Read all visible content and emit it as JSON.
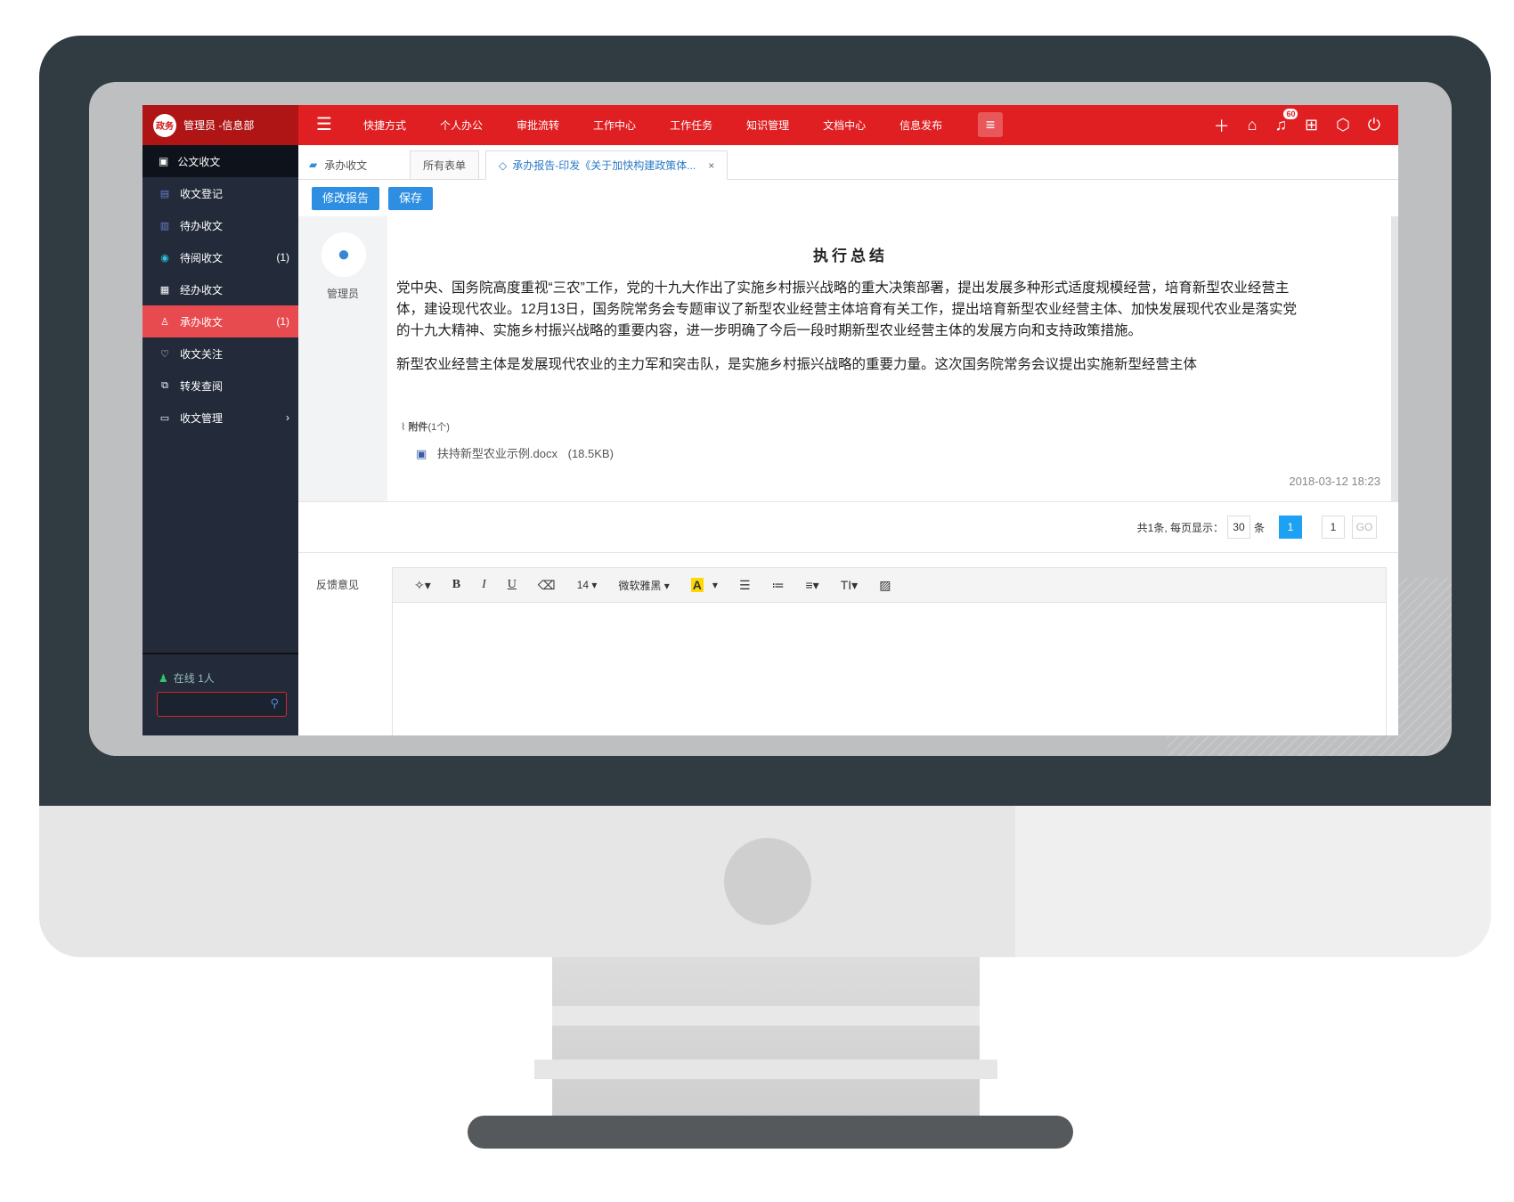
{
  "brand": {
    "logo_text": "政务",
    "user_text": "管理员 -信息部"
  },
  "topnav": {
    "items": [
      "快捷方式",
      "个人办公",
      "审批流转",
      "工作中心",
      "工作任务",
      "知识管理",
      "文档中心",
      "信息发布"
    ],
    "notification_count": "60"
  },
  "sidebar": {
    "header": "公文收文",
    "items": [
      {
        "label": "收文登记",
        "count": "",
        "icon": "register-icon"
      },
      {
        "label": "待办收文",
        "count": "",
        "icon": "todo-icon"
      },
      {
        "label": "待阅收文",
        "count": "(1)",
        "icon": "eye-icon"
      },
      {
        "label": "经办收文",
        "count": "",
        "icon": "handled-icon"
      },
      {
        "label": "承办收文",
        "count": "(1)",
        "icon": "user-icon"
      },
      {
        "label": "收文关注",
        "count": "",
        "icon": "heart-icon"
      },
      {
        "label": "转发查阅",
        "count": "",
        "icon": "forward-icon"
      },
      {
        "label": "收文管理",
        "count": "",
        "icon": "folder-icon"
      }
    ],
    "active_index": 4,
    "online_text": "在线 1人",
    "search_placeholder": ""
  },
  "tabs": {
    "home": "承办收文",
    "all": "所有表单",
    "current": "承办报告-印发《关于加快构建政策体..."
  },
  "buttons": {
    "modify": "修改报告",
    "save": "保存"
  },
  "document": {
    "author": "管理员",
    "title": "执行总结",
    "paragraph1": "党中央、国务院高度重视“三农”工作，党的十九大作出了实施乡村振兴战略的重大决策部署，提出发展多种形式适度规模经营，培育新型农业经营主体，建设现代农业。12月13日，国务院常务会专题审议了新型农业经营主体培育有关工作，提出培育新型农业经营主体、加快发展现代农业是落实党的十九大精神、实施乡村振兴战略的重要内容，进一步明确了今后一段时期新型农业经营主体的发展方向和支持政策措施。",
    "paragraph2": "新型农业经营主体是发展现代农业的主力军和突击队，是实施乡村振兴战略的重要力量。这次国务院常务会议提出实施新型经营主体",
    "attachment_label": "附件",
    "attachment_count": "(1个)",
    "attachment_file": "扶持新型农业示例.docx",
    "attachment_size": "(18.5KB)",
    "date": "2018-03-12 18:23"
  },
  "pager": {
    "summary": "共1条, 每页显示：",
    "per_page": "30",
    "unit": "条",
    "current_page": "1",
    "jump_value": "1",
    "go": "GO"
  },
  "feedback": {
    "label": "反馈意见",
    "font_size": "14",
    "font_name": "微软雅黑"
  }
}
